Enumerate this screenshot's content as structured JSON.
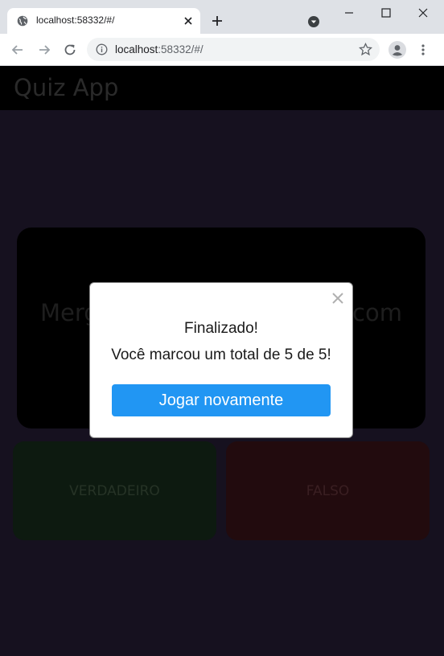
{
  "browser": {
    "tab_title": "localhost:58332/#/",
    "url_host": "localhost",
    "url_rest": ":58332/#/"
  },
  "app": {
    "title": "Quiz App",
    "question_visible_left": "Merge",
    "question_visible_right": "m com",
    "answers": {
      "true_label": "VERDADEIRO",
      "false_label": "FALSO"
    }
  },
  "modal": {
    "title": "Finalizado!",
    "message": "Você marcou um total de 5 de 5!",
    "button_label": "Jogar novamente"
  },
  "colors": {
    "accent": "#2196f3",
    "app_background": "#16111f",
    "true_button": "#0d1a10",
    "false_button": "#220b0e"
  }
}
